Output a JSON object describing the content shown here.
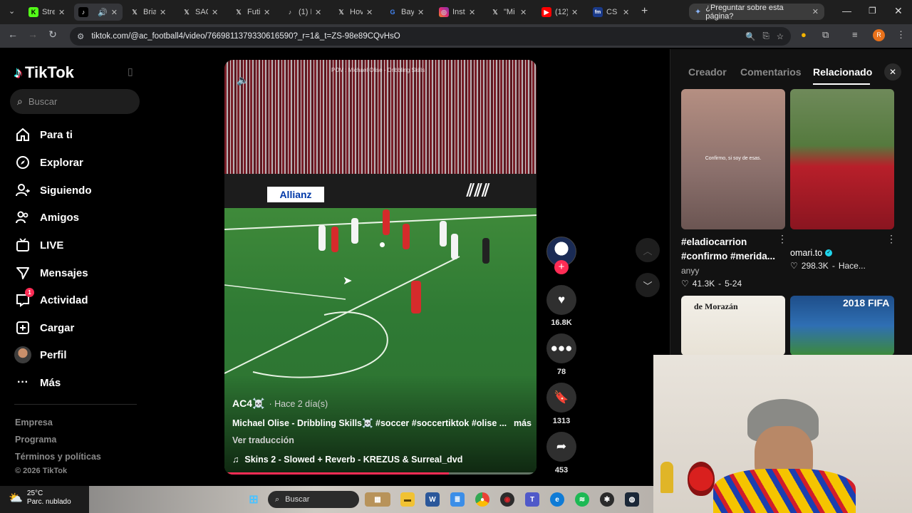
{
  "browser": {
    "tabs": [
      {
        "label": "Stre",
        "icon": "kick-icon",
        "color": "#53fc18"
      },
      {
        "label": "",
        "icon": "tiktok-icon",
        "color": "#000000",
        "active": true
      },
      {
        "label": "Bria",
        "icon": "x-icon",
        "color": "#000000"
      },
      {
        "label": "SAC",
        "icon": "x-icon",
        "color": "#000000"
      },
      {
        "label": "Futi",
        "icon": "x-icon",
        "color": "#000000"
      },
      {
        "label": "(1) F",
        "icon": "tiktok-icon",
        "color": "#000000"
      },
      {
        "label": "Hov",
        "icon": "x-icon",
        "color": "#000000"
      },
      {
        "label": "Bay",
        "icon": "google-icon",
        "color": "#ffffff"
      },
      {
        "label": "Inst",
        "icon": "instagram-icon",
        "color": "#e1306c"
      },
      {
        "label": "\"Mi",
        "icon": "x-icon",
        "color": "#000000"
      },
      {
        "label": "(12)",
        "icon": "youtube-icon",
        "color": "#ff0000"
      },
      {
        "label": "CS",
        "icon": "fm-icon",
        "color": "#1a3a8a"
      }
    ],
    "ask_pill": "¿Preguntar sobre esta página?",
    "url": "tiktok.com/@ac_football4/video/7669811379330616590?_r=1&_t=ZS-98e89CQvHsO"
  },
  "sidebar": {
    "logo": "TikTok",
    "search_placeholder": "Buscar",
    "items": [
      {
        "label": "Para ti",
        "icon": "home-icon"
      },
      {
        "label": "Explorar",
        "icon": "compass-icon"
      },
      {
        "label": "Siguiendo",
        "icon": "following-icon"
      },
      {
        "label": "Amigos",
        "icon": "friends-icon"
      },
      {
        "label": "LIVE",
        "icon": "live-icon"
      },
      {
        "label": "Mensajes",
        "icon": "messages-icon"
      },
      {
        "label": "Actividad",
        "icon": "activity-icon",
        "badge": "1"
      },
      {
        "label": "Cargar",
        "icon": "upload-icon"
      },
      {
        "label": "Perfil",
        "icon": "avatar"
      },
      {
        "label": "Más",
        "icon": "more-icon"
      }
    ],
    "footer": [
      "Empresa",
      "Programa",
      "Términos y políticas",
      "© 2026 TikTok"
    ]
  },
  "video": {
    "overlay_caption": "POV : Michael Olise - Dribbling Skills",
    "author": "AC4☠️",
    "time_ago": "· Hace 2 día(s)",
    "description": "Michael Olise - Dribbling Skills☠️ #soccer #soccertiktok #olise ...",
    "more": "más",
    "translate": "Ver traducción",
    "music": "Skins 2 - Slowed + Reverb - KREZUS & Surreal_dvd",
    "progress": 0.72,
    "board_text": "Allianz"
  },
  "actions": {
    "likes": "16.8K",
    "comments": "78",
    "saves": "1313",
    "shares": "453"
  },
  "panel": {
    "tabs": [
      "Creador",
      "Comentarios",
      "Relacionado"
    ],
    "active_tab": "Relacionado",
    "cards": [
      {
        "title": "#eladiocarrion #confirmo #merida...",
        "author": "anyy",
        "likes": "41.3K",
        "date": "5-24",
        "thumb_text": "Confirmo, si soy de esas."
      },
      {
        "title": "omari.to",
        "author": "",
        "likes": "298.3K",
        "date": "Hace...",
        "verified": true
      }
    ],
    "thumb3_text": "de Morazán",
    "thumb4_text": "2018 FIFA"
  },
  "taskbar": {
    "temp": "25°C",
    "weather": "Parc. nublado",
    "search": "Buscar"
  }
}
